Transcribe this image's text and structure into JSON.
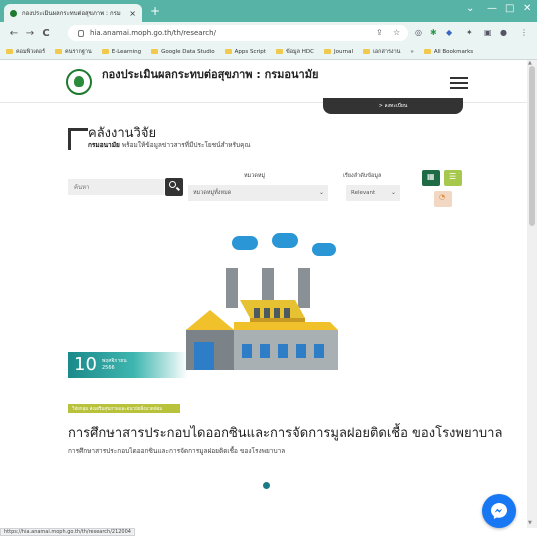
{
  "browser": {
    "tab_title": "กองประเมินผลกระทบต่อสุขภาพ : กรม",
    "tab_close": "×",
    "new_tab": "+",
    "url": "hia.anamai.moph.go.th/th/research/",
    "status_url": "https://hia.anamai.moph.go.th/th/research/212004",
    "bookmarks": [
      "คอมพิวเตอร์",
      "คนรากฐาน",
      "E-Learning",
      "Google Data Studio",
      "Apps Script",
      "ข้อมูล HDC",
      "Journal",
      "เอกสารงาน"
    ],
    "bookmarks_overflow": "»",
    "all_bookmarks": "All Bookmarks"
  },
  "site": {
    "title": "กองประเมินผลกระทบต่อสุขภาพ : กรมอนามัย",
    "banner_label": "> ลงทะเบียน"
  },
  "section": {
    "title": "คลังงานวิจัย",
    "subtitle_bold": "กรมอนามัย",
    "subtitle_rest": " พร้อมให้ข้อมูลข่าวสารที่มีประโยชน์สำหรับคุณ"
  },
  "filters": {
    "search_placeholder": "ค้นหา",
    "category_label": "หมวดหมู่",
    "category_value": "หมวดหมู่ทั้งหมด",
    "sort_label": "เรียงลำดับข้อมูล",
    "sort_value": "Relevant"
  },
  "article": {
    "day": "10",
    "month": "พฤศจิกายน",
    "year": "2566",
    "category": "วิจัยกลุ่ม ส่งเสริมสุขภาพและอนามัยสิ่งแวดล้อม",
    "title": "การศึกษาสารประกอบไดออกซินและการจัดการมูลฝอยติดเชื้อ ของโรงพยาบาล",
    "summary": "การศึกษาสารประกอบไดออกซินและการจัดการมูลฝอยติดเชื้อ ของโรงพยาบาล"
  },
  "colors": {
    "tab_bar": "#56b3a6",
    "primary_dark": "#333333",
    "green": "#1e6b45",
    "lime": "#a6c84c",
    "teal": "#1b8a8a",
    "messenger": "#1877f2"
  },
  "icons": {
    "back": "←",
    "forward": "→",
    "reload": "C",
    "search": "search-icon",
    "grid": "grid-view-icon",
    "list": "list-view-icon",
    "rss": "rss-icon",
    "messenger": "messenger-icon"
  }
}
